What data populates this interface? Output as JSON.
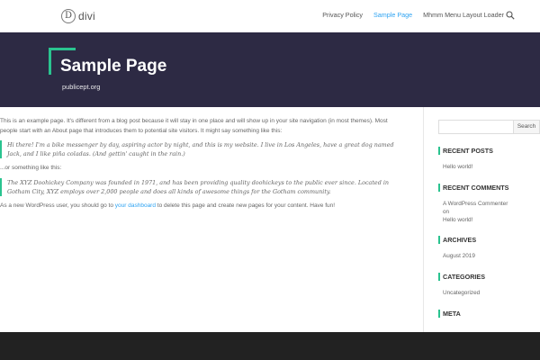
{
  "header": {
    "logo_mark": "D",
    "logo_text": "divi",
    "nav": [
      {
        "label": "Privacy Policy",
        "active": false
      },
      {
        "label": "Sample Page",
        "active": true
      },
      {
        "label": "Mhmm Menu Layout Loader",
        "active": false
      }
    ],
    "search_icon": "search-icon"
  },
  "hero": {
    "title": "Sample Page",
    "subtitle": "publicept.org"
  },
  "content": {
    "intro": "This is an example page. It's different from a blog post because it will stay in one place and will show up in your site navigation (in most themes). Most people start with an About page that introduces them to potential site visitors. It might say something like this:",
    "quote1": "Hi there! I'm a bike messenger by day, aspiring actor by night, and this is my website. I live in Los Angeles, have a great dog named Jack, and I like piña coladas. (And gettin' caught in the rain.)",
    "middle": "...or something like this:",
    "quote2": "The XYZ Doohickey Company was founded in 1971, and has been providing quality doohickeys to the public ever since. Located in Gotham City, XYZ employs over 2,000 people and does all kinds of awesome things for the Gotham community.",
    "outro_before": "As a new WordPress user, you should go to ",
    "outro_link": "your dashboard",
    "outro_after": " to delete this page and create new pages for your content. Have fun!"
  },
  "sidebar": {
    "search_placeholder": "",
    "search_button": "Search",
    "recent_posts": {
      "title": "RECENT POSTS",
      "items": [
        "Hello world!"
      ]
    },
    "recent_comments": {
      "title": "RECENT COMMENTS",
      "author": "A WordPress Commenter",
      "on": "on",
      "post": "Hello world!"
    },
    "archives": {
      "title": "ARCHIVES",
      "items": [
        "August 2019"
      ]
    },
    "categories": {
      "title": "CATEGORIES",
      "items": [
        "Uncategorized"
      ]
    },
    "meta": {
      "title": "META"
    }
  },
  "colors": {
    "accent": "#2ac38f",
    "link": "#2ea3f2",
    "hero_bg": "#2d2a44",
    "footer_bg": "#222222"
  }
}
